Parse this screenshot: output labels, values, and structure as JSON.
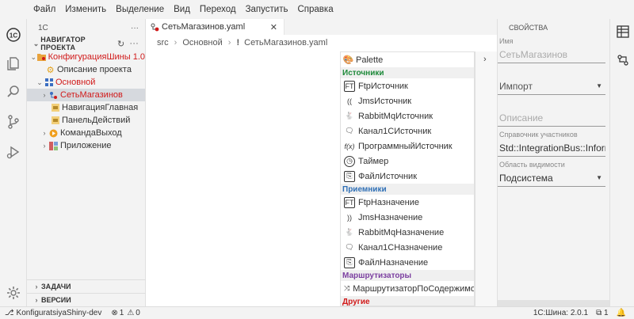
{
  "menu": [
    "Файл",
    "Изменить",
    "Выделение",
    "Вид",
    "Переход",
    "Запустить",
    "Справка"
  ],
  "sidebar": {
    "title": "1С",
    "more": "···",
    "section": "НАВИГАТОР ПРОЕКТА",
    "tree": {
      "config": "КонфигурацияШины 1.0",
      "project_desc": "Описание проекта",
      "main": "Основной",
      "networks": "СетьМагазинов",
      "nav_main": "НавигацияГлавная",
      "actions_panel": "ПанельДействий",
      "cmd_exit": "КомандаВыход",
      "app": "Приложение"
    },
    "tasks": "ЗАДАЧИ",
    "versions": "ВЕРСИИ"
  },
  "editor": {
    "tab": "СетьМагазинов.yaml",
    "breadcrumbs": [
      "src",
      "Основной",
      "СетьМагазинов.yaml"
    ],
    "palette": {
      "title": "Palette",
      "sources_title": "Источники",
      "sources": [
        "FtpИсточник",
        "JmsИсточник",
        "RabbitMqИсточник",
        "Канал1СИсточник",
        "ПрограммныйИсточник",
        "Таймер",
        "ФайлИсточник"
      ],
      "receivers_title": "Приемники",
      "receivers": [
        "FtpНазначение",
        "JmsНазначение",
        "RabbitMqНазначение",
        "Канал1СНазначение",
        "ФайлНазначение"
      ],
      "routers_title": "Маршрутизаторы",
      "routers": [
        "МаршрутизаторПоСодержимому"
      ],
      "other_title": "Другие"
    }
  },
  "properties": {
    "title": "СВОЙСТВА",
    "name_label": "Имя",
    "name_value": "СетьМагазинов",
    "import_label": "Импорт",
    "desc_placeholder": "Описание",
    "participants_label": "Справочник участников",
    "participants_value": "Std::IntegrationBus::Inform",
    "scope_label": "Область видимости",
    "scope_value": "Подсистема"
  },
  "status": {
    "branch": "KonfiguratsiyaShiny-dev",
    "errors": "1",
    "warnings": "0",
    "version": "1С:Шина: 2.0.1",
    "notifications": "1"
  },
  "colors": {
    "sources": "#1e8a3a",
    "receivers": "#2f6fb5",
    "routers": "#7b3fa0",
    "other": "#d11a1a",
    "accent_red": "#d11a1a"
  }
}
